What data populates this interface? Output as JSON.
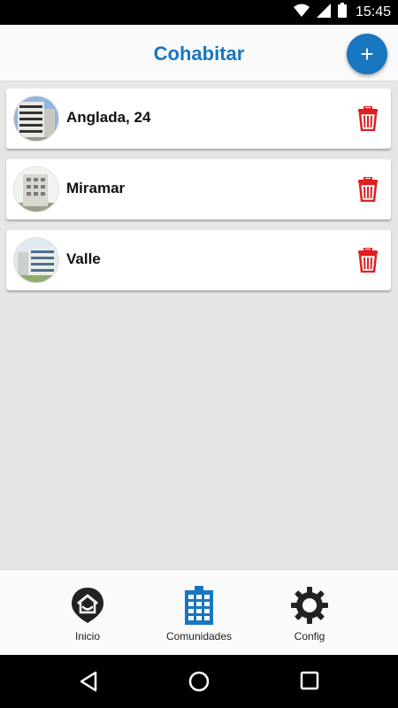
{
  "status_bar": {
    "time": "15:45"
  },
  "app_bar": {
    "title": "Cohabitar",
    "add_label": "+"
  },
  "communities": [
    {
      "name": "Anglada, 24"
    },
    {
      "name": "Miramar"
    },
    {
      "name": "Valle"
    }
  ],
  "bottom_nav": {
    "items": [
      {
        "label": "Inicio",
        "icon": "home-pin-icon"
      },
      {
        "label": "Comunidades",
        "icon": "building-icon"
      },
      {
        "label": "Config",
        "icon": "gear-icon"
      }
    ]
  },
  "colors": {
    "accent": "#1976c0",
    "delete": "#e02020"
  }
}
